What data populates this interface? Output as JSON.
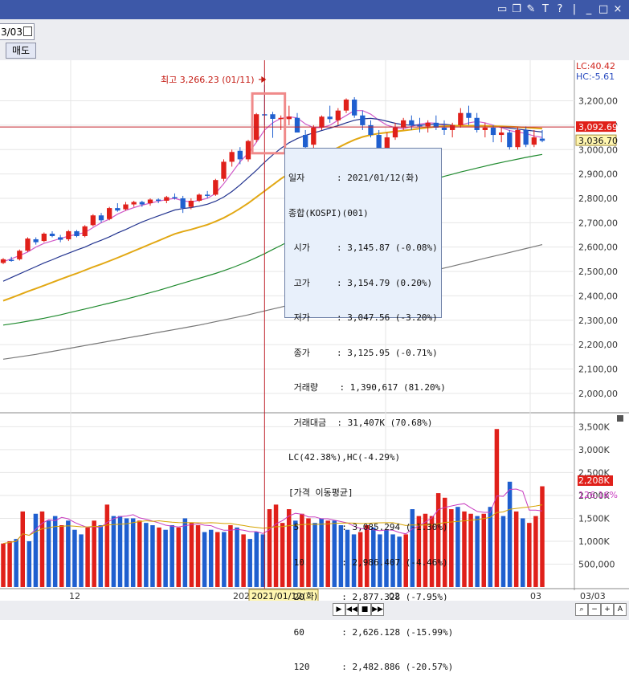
{
  "toolbar": {
    "date_value": "3/03",
    "sell_label": "매도"
  },
  "titlebar_icons": [
    "window-icon",
    "layout-icon",
    "tool-icon",
    "T",
    "?",
    "_",
    "□",
    "×"
  ],
  "chart_data": [
    {
      "type": "candlestick",
      "title": "",
      "y_range": [
        1950,
        3350
      ],
      "y_ticks": [
        "3,200,00",
        "3,100,00",
        "3,000,00",
        "2,900,00",
        "2,800,00",
        "2,700,00",
        "2,600,00",
        "2,500,00",
        "2,400,00",
        "2,300,00",
        "2,200,00",
        "2,100,00",
        "2,000,00"
      ],
      "y_tick_values": [
        3200,
        3100,
        3000,
        2900,
        2800,
        2700,
        2600,
        2500,
        2400,
        2300,
        2200,
        2100,
        2000
      ],
      "lc_label": "LC:40.42",
      "hc_label": "HC:-5.61",
      "last_price_label": "3,036.70",
      "crosshair_label": "3,092.69",
      "crosshair_value": 3092.69,
      "last_value": 3036.7,
      "max_annotation": "최고 3,266.23 (01/11)",
      "max_value": 3266.23,
      "candles": [
        [
          2535,
          2555,
          2530,
          2550
        ],
        [
          2548,
          2560,
          2540,
          2545
        ],
        [
          2550,
          2590,
          2545,
          2585
        ],
        [
          2585,
          2640,
          2580,
          2635
        ],
        [
          2632,
          2640,
          2610,
          2620
        ],
        [
          2625,
          2660,
          2620,
          2655
        ],
        [
          2655,
          2665,
          2640,
          2645
        ],
        [
          2640,
          2650,
          2620,
          2630
        ],
        [
          2632,
          2670,
          2625,
          2665
        ],
        [
          2665,
          2670,
          2640,
          2645
        ],
        [
          2645,
          2690,
          2640,
          2685
        ],
        [
          2690,
          2735,
          2685,
          2730
        ],
        [
          2730,
          2740,
          2700,
          2710
        ],
        [
          2715,
          2765,
          2710,
          2760
        ],
        [
          2760,
          2780,
          2745,
          2750
        ],
        [
          2755,
          2785,
          2750,
          2775
        ],
        [
          2775,
          2790,
          2765,
          2785
        ],
        [
          2785,
          2790,
          2765,
          2775
        ],
        [
          2780,
          2800,
          2770,
          2795
        ],
        [
          2795,
          2800,
          2780,
          2790
        ],
        [
          2790,
          2810,
          2780,
          2805
        ],
        [
          2805,
          2820,
          2795,
          2800
        ],
        [
          2800,
          2810,
          2740,
          2760
        ],
        [
          2765,
          2800,
          2755,
          2790
        ],
        [
          2790,
          2820,
          2785,
          2815
        ],
        [
          2815,
          2830,
          2800,
          2810
        ],
        [
          2815,
          2880,
          2810,
          2875
        ],
        [
          2880,
          2960,
          2870,
          2950
        ],
        [
          2950,
          3000,
          2930,
          2990
        ],
        [
          2995,
          3010,
          2940,
          2960
        ],
        [
          2960,
          3040,
          2950,
          3035
        ],
        [
          3040,
          3150,
          3030,
          3145
        ],
        [
          3145,
          3266,
          3100,
          3140
        ],
        [
          3145,
          3155,
          3048,
          3126
        ],
        [
          3125,
          3140,
          3080,
          3130
        ],
        [
          3125,
          3180,
          3100,
          3135
        ],
        [
          3130,
          3150,
          3070,
          3070
        ],
        [
          3060,
          3080,
          2985,
          3010
        ],
        [
          3020,
          3100,
          3000,
          3090
        ],
        [
          3090,
          3140,
          3080,
          3135
        ],
        [
          3135,
          3180,
          3110,
          3125
        ],
        [
          3120,
          3170,
          3100,
          3160
        ],
        [
          3160,
          3210,
          3150,
          3205
        ],
        [
          3205,
          3215,
          3130,
          3140
        ],
        [
          3140,
          3160,
          3080,
          3100
        ],
        [
          3100,
          3120,
          3050,
          3060
        ],
        [
          3060,
          3080,
          2980,
          2990
        ],
        [
          2990,
          3070,
          2980,
          3050
        ],
        [
          3050,
          3110,
          3040,
          3090
        ],
        [
          3090,
          3130,
          3080,
          3120
        ],
        [
          3120,
          3140,
          3080,
          3100
        ],
        [
          3100,
          3130,
          3070,
          3095
        ],
        [
          3095,
          3120,
          3070,
          3110
        ],
        [
          3110,
          3140,
          3080,
          3090
        ],
        [
          3090,
          3120,
          3060,
          3080
        ],
        [
          3080,
          3110,
          3050,
          3100
        ],
        [
          3100,
          3170,
          3090,
          3150
        ],
        [
          3150,
          3180,
          3100,
          3130
        ],
        [
          3130,
          3150,
          3070,
          3080
        ],
        [
          3080,
          3110,
          3050,
          3090
        ],
        [
          3090,
          3100,
          3030,
          3060
        ],
        [
          3060,
          3090,
          3030,
          3070
        ],
        [
          3070,
          3080,
          3000,
          3010
        ],
        [
          3010,
          3090,
          3000,
          3080
        ],
        [
          3080,
          3095,
          3010,
          3020
        ],
        [
          3020,
          3080,
          3010,
          3050
        ],
        [
          3045,
          3080,
          3030,
          3036
        ]
      ],
      "ma_series": [
        {
          "color": "#d05bc8",
          "values": [
            2540,
            2552,
            2565,
            2580,
            2600,
            2615,
            2625,
            2635,
            2645,
            2652,
            2660,
            2680,
            2700,
            2715,
            2735,
            2750,
            2762,
            2772,
            2780,
            2788,
            2795,
            2800,
            2790,
            2785,
            2792,
            2800,
            2820,
            2860,
            2905,
            2950,
            2985,
            3030,
            3080,
            3110,
            3128,
            3135,
            3130,
            3105,
            3090,
            3090,
            3100,
            3120,
            3140,
            3160,
            3160,
            3145,
            3120,
            3100,
            3090,
            3085,
            3095,
            3105,
            3110,
            3108,
            3100,
            3095,
            3100,
            3110,
            3115,
            3110,
            3100,
            3090,
            3078,
            3072,
            3066,
            3056,
            3050
          ]
        },
        {
          "color": "#22338f",
          "values": [
            2460,
            2475,
            2490,
            2505,
            2520,
            2535,
            2548,
            2562,
            2575,
            2588,
            2600,
            2615,
            2628,
            2642,
            2658,
            2672,
            2688,
            2703,
            2716,
            2728,
            2740,
            2752,
            2758,
            2762,
            2768,
            2776,
            2788,
            2805,
            2828,
            2855,
            2885,
            2915,
            2948,
            2978,
            3005,
            3028,
            3045,
            3058,
            3068,
            3078,
            3088,
            3098,
            3110,
            3120,
            3126,
            3128,
            3124,
            3116,
            3108,
            3102,
            3100,
            3100,
            3102,
            3104,
            3104,
            3100,
            3098,
            3098,
            3098,
            3098,
            3096,
            3092,
            3088,
            3084,
            3080,
            3076,
            3072
          ]
        },
        {
          "color": "#e2a814",
          "values": [
            2380,
            2392,
            2405,
            2418,
            2430,
            2442,
            2455,
            2468,
            2480,
            2492,
            2505,
            2518,
            2530,
            2543,
            2556,
            2570,
            2584,
            2598,
            2612,
            2626,
            2640,
            2654,
            2664,
            2672,
            2682,
            2692,
            2705,
            2720,
            2738,
            2758,
            2780,
            2805,
            2830,
            2855,
            2880,
            2902,
            2922,
            2940,
            2958,
            2975,
            2992,
            3008,
            3025,
            3040,
            3052,
            3060,
            3066,
            3070,
            3074,
            3078,
            3082,
            3086,
            3090,
            3094,
            3096,
            3098,
            3098,
            3098,
            3098,
            3097,
            3096,
            3095,
            3094,
            3092,
            3090,
            3088,
            3086
          ]
        },
        {
          "color": "#1f8a2e",
          "values": [
            2280,
            2285,
            2290,
            2296,
            2302,
            2308,
            2315,
            2322,
            2330,
            2338,
            2346,
            2354,
            2362,
            2370,
            2378,
            2386,
            2395,
            2404,
            2413,
            2422,
            2432,
            2442,
            2452,
            2462,
            2472,
            2482,
            2492,
            2503,
            2515,
            2528,
            2542,
            2557,
            2573,
            2590,
            2607,
            2624,
            2641,
            2658,
            2675,
            2692,
            2709,
            2726,
            2742,
            2758,
            2773,
            2787,
            2800,
            2813,
            2825,
            2837,
            2848,
            2859,
            2870,
            2880,
            2890,
            2899,
            2908,
            2916,
            2924,
            2932,
            2940,
            2947,
            2954,
            2961,
            2968,
            2974,
            2980
          ]
        },
        {
          "color": "#777777",
          "values": [
            2140,
            2145,
            2150,
            2155,
            2160,
            2166,
            2172,
            2178,
            2184,
            2190,
            2196,
            2202,
            2208,
            2214,
            2220,
            2226,
            2232,
            2238,
            2244,
            2250,
            2256,
            2262,
            2268,
            2274,
            2280,
            2287,
            2294,
            2301,
            2308,
            2315,
            2322,
            2330,
            2338,
            2346,
            2354,
            2362,
            2370,
            2378,
            2386,
            2394,
            2402,
            2410,
            2418,
            2426,
            2434,
            2442,
            2450,
            2458,
            2466,
            2474,
            2482,
            2490,
            2498,
            2506,
            2514,
            2522,
            2530,
            2538,
            2546,
            2554,
            2562,
            2570,
            2578,
            2586,
            2594,
            2602,
            2610
          ]
        }
      ]
    },
    {
      "type": "bar",
      "title": "",
      "y_range": [
        0,
        3700000
      ],
      "y_ticks": [
        "3,500K",
        "3,000K",
        "2,500K",
        "2,000K",
        "1,500K",
        "1,000K",
        "500,000"
      ],
      "y_tick_values": [
        3500000,
        3000000,
        2500000,
        2000000,
        1500000,
        1000000,
        500000
      ],
      "last_label": "2,208K",
      "ratio_label": "126.16%",
      "volumes": [
        950000,
        1000000,
        1050000,
        1650000,
        1000000,
        1600000,
        1650000,
        1450000,
        1550000,
        1350000,
        1450000,
        1250000,
        1150000,
        1300000,
        1450000,
        1350000,
        1800000,
        1550000,
        1550000,
        1500000,
        1500000,
        1450000,
        1400000,
        1350000,
        1300000,
        1250000,
        1350000,
        1300000,
        1500000,
        1400000,
        1350000,
        1200000,
        1250000,
        1200000,
        1200000,
        1350000,
        1300000,
        1150000,
        1050000,
        1200000,
        1150000,
        1700000,
        1800000,
        1400000,
        1700000,
        1450000,
        1600000,
        1500000,
        1400000,
        1500000,
        1450000,
        1450000,
        1350000,
        1250000,
        1150000,
        1200000,
        1350000,
        1300000,
        1150000,
        1250000,
        1150000,
        1100000,
        1150000,
        1700000,
        1550000,
        1600000,
        1550000,
        2050000,
        1950000,
        1700000,
        1750000,
        1650000,
        1600000,
        1550000,
        1600000,
        1750000,
        3450000,
        1550000,
        2300000,
        1650000,
        1500000,
        1400000,
        1550000,
        2200000
      ],
      "colors_up_down": "mixed"
    }
  ],
  "x_axis": {
    "labels": [
      "12",
      "2021/01/12(화)",
      "02",
      "03",
      "03/03"
    ]
  },
  "tooltip": {
    "lines": [
      "일자      : 2021/01/12(화)",
      "종합(KOSPI)(001)",
      " 시가     : 3,145.87 (-0.08%)",
      " 고가     : 3,154.79 (0.20%)",
      " 저가     : 3,047.56 (-3.20%)",
      " 종가     : 3,125.95 (-0.71%)",
      " 거래량    : 1,390,617 (81.20%)",
      " 거래대금  : 31,407K (70.68%)",
      "LC(42.38%),HC(-4.29%)",
      "[가격 이동평균]",
      " 5        : 3,085.294 (-1.30%)",
      " 10       : 2,986.407 (-4.46%)",
      " 20       : 2,877.328 (-7.95%)",
      " 60       : 2,626.128 (-15.99%)",
      " 120      : 2,482.886 (-20.57%)"
    ]
  },
  "colors": {
    "up": "#e0201a",
    "down": "#1f5fcf",
    "titlebar": "#3d58a8",
    "highlight": "#f08a8a"
  }
}
